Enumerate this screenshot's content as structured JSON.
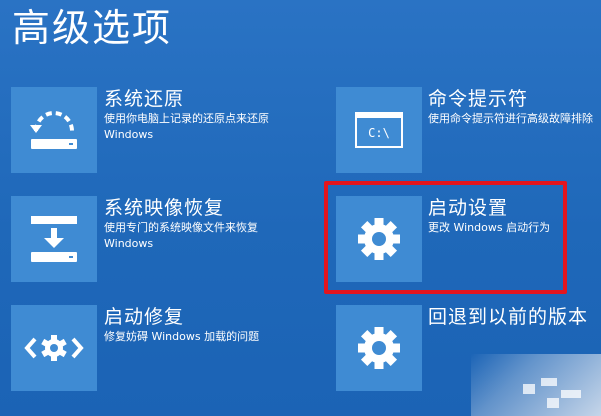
{
  "page": {
    "title": "高级选项"
  },
  "options": [
    {
      "title": "系统还原",
      "desc_line1": "使用你电脑上记录的还原点来还原",
      "desc_line2": "Windows",
      "icon": "system-restore-icon"
    },
    {
      "title": "命令提示符",
      "desc_line1": "使用命令提示符进行高级故障排除",
      "desc_line2": "",
      "icon": "command-prompt-icon"
    },
    {
      "title": "系统映像恢复",
      "desc_line1": "使用专门的系统映像文件来恢复",
      "desc_line2": "Windows",
      "icon": "system-image-recovery-icon"
    },
    {
      "title": "启动设置",
      "desc_line1": "更改 Windows 启动行为",
      "desc_line2": "",
      "icon": "gear-icon"
    },
    {
      "title": "启动修复",
      "desc_line1": "修复妨碍 Windows 加载的问题",
      "desc_line2": "",
      "icon": "startup-repair-icon"
    },
    {
      "title": "回退到以前的版本",
      "desc_line1": "",
      "desc_line2": "",
      "icon": "gear-icon"
    }
  ],
  "cmd_icon_text": "C:\\",
  "colors": {
    "background": "#1f68b9",
    "tile": "#3f8bd3",
    "highlight_border": "#e3151e",
    "text": "#ffffff"
  }
}
